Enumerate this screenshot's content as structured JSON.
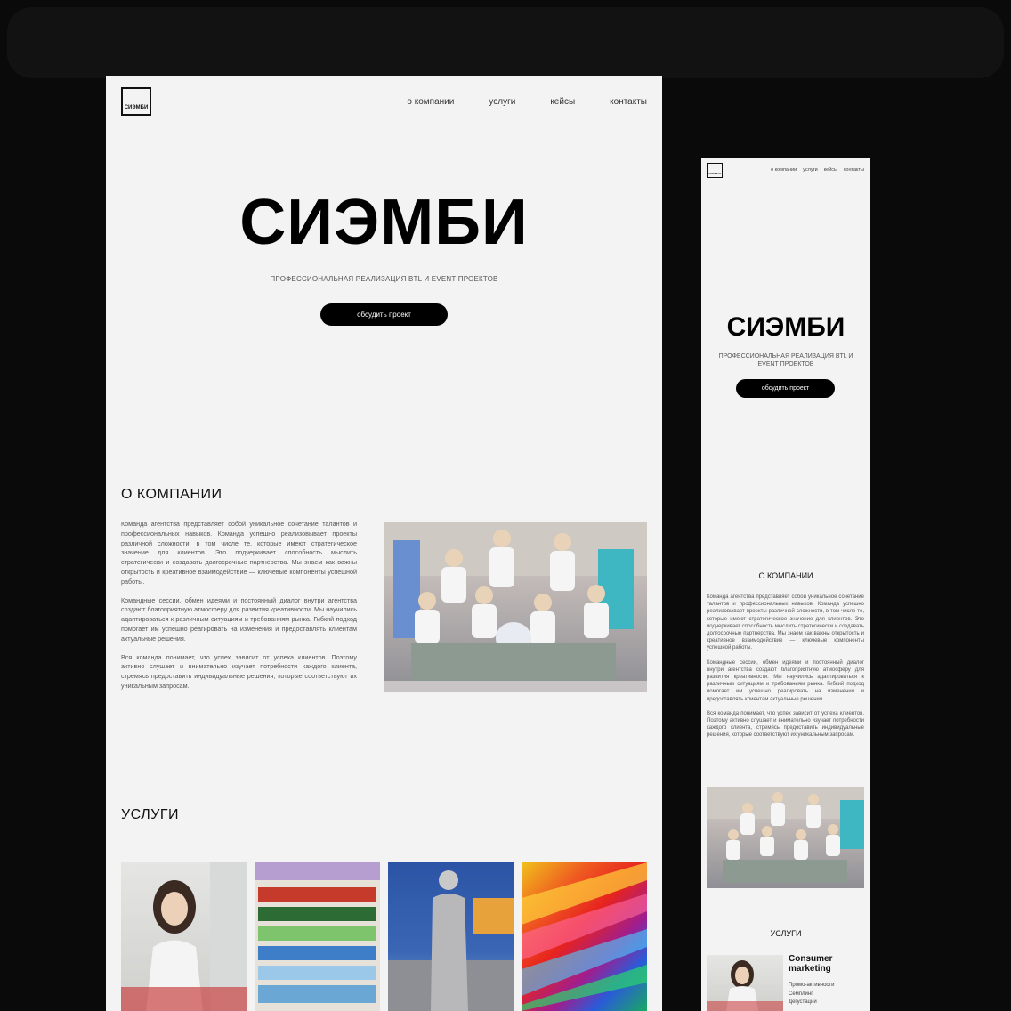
{
  "brand": {
    "logo_text": "СИЭМБИ"
  },
  "nav": [
    "о компании",
    "услуги",
    "кейсы",
    "контакты"
  ],
  "hero": {
    "title": "СИЭМБИ",
    "subtitle": "ПРОФЕССИОНАЛЬНАЯ РЕАЛИЗАЦИЯ BTL И EVENT ПРОЕКТОВ",
    "cta": "обсудить проект"
  },
  "about": {
    "title": "О КОМПАНИИ",
    "paragraphs": [
      "Команда агентства представляет собой уникальное сочетание талантов и профессиональных навыков. Команда успешно реализовывает проекты различной сложности, в том числе те, которые имеют стратегическое значение для клиентов. Это подчеркивает способность мыслить стратегически и создавать долгосрочные партнерства. Мы знаем как важны открытость и креативное взаимодействие — ключевые компоненты успешной работы.",
      "Командные сессии, обмен идеями и постоянный диалог внутри агентства создают благоприятную атмосферу для развития креативности. Мы научились адаптироваться к различным ситуациям и требованиям рынка. Гибкий подход помогает им успешно реагировать на изменения и предоставлять клиентам актуальные решения.",
      "Вся команда понимает, что успех зависит от успеха клиентов. Поэтому активно слушает и внимательно изучает потребности каждого клиента, стремясь предоставить индивидуальные решения, которые соответствуют их уникальным запросам."
    ]
  },
  "services": {
    "title": "УСЛУГИ",
    "mobile_title": "УСЛУГИ",
    "first": {
      "name": "Consumer marketing",
      "items": [
        "Промо-активности",
        "Семплинг",
        "Дегустации"
      ]
    }
  },
  "colors": {
    "background": "#0a0a0a",
    "page": "#f3f3f3",
    "text": "#111111",
    "button": "#000000"
  }
}
